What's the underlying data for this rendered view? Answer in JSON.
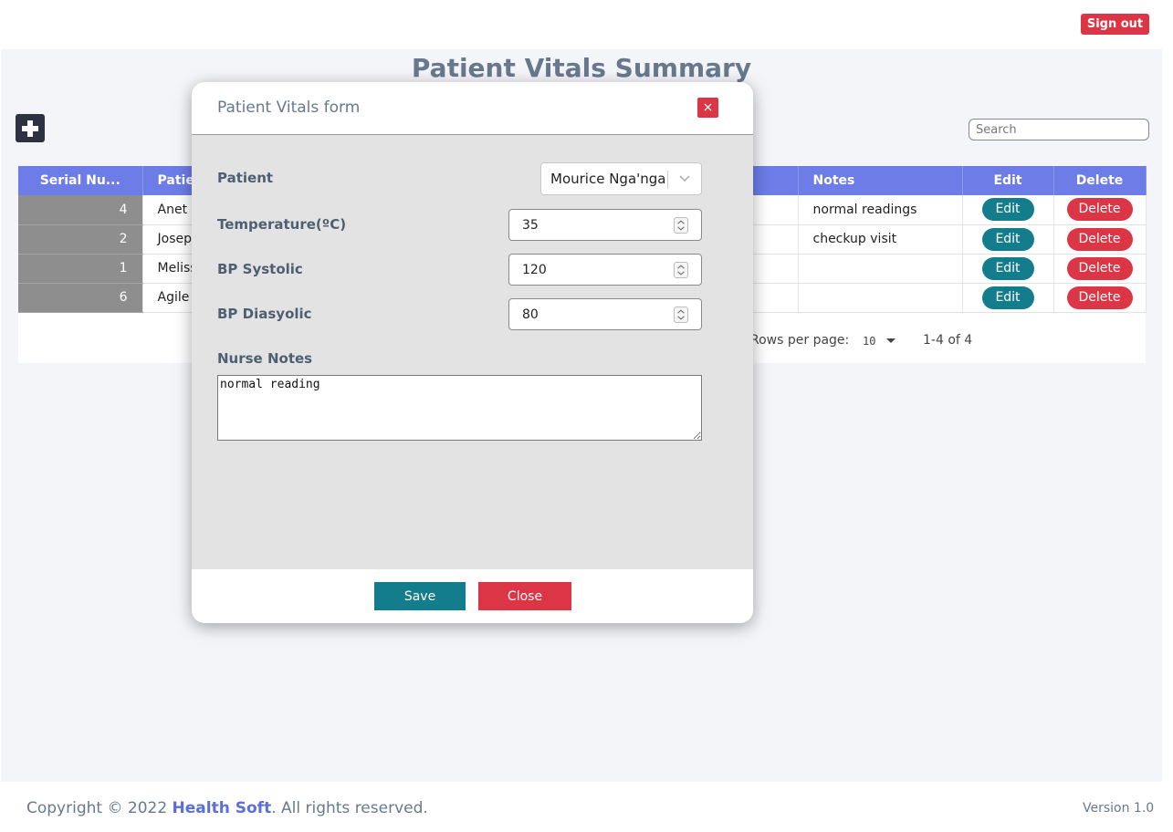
{
  "header": {
    "signout_label": "Sign out"
  },
  "page": {
    "title": "Patient Vitals Summary",
    "search_placeholder": "Search",
    "add_icon": "plus-square-icon"
  },
  "table": {
    "columns": [
      "Serial Nu...",
      "Patient",
      "Notes",
      "Edit",
      "Delete"
    ],
    "rows": [
      {
        "serial": "4",
        "patient": "Anet",
        "notes": "normal readings",
        "edit": "Edit",
        "delete": "Delete"
      },
      {
        "serial": "2",
        "patient": "Josep",
        "notes": "checkup visit",
        "edit": "Edit",
        "delete": "Delete"
      },
      {
        "serial": "1",
        "patient": "Meliss",
        "notes": "",
        "edit": "Edit",
        "delete": "Delete"
      },
      {
        "serial": "6",
        "patient": "Agile",
        "notes": "",
        "edit": "Edit",
        "delete": "Delete"
      }
    ]
  },
  "pagination": {
    "rows_per_page_label": "Rows per page:",
    "rows_per_page_value": "10",
    "range": "1-4 of 4"
  },
  "modal": {
    "title": "Patient Vitals form",
    "close_glyph": "×",
    "patient_label": "Patient",
    "patient_value": "Mourice Nga'nga",
    "temperature_label": "Temperature(ºC)",
    "temperature_value": "35",
    "bp_systolic_label": "BP Systolic",
    "bp_systolic_value": "120",
    "bp_diastolic_label": "BP Diasyolic",
    "bp_diastolic_value": "80",
    "nurse_notes_label": "Nurse Notes",
    "nurse_notes_value": "normal reading",
    "save_label": "Save",
    "close_label": "Close"
  },
  "footer": {
    "copyright_prefix": "Copyright © 2022 ",
    "brand": "Health Soft",
    "copyright_suffix": ". All rights reserved.",
    "version": "Version 1.0"
  },
  "colors": {
    "accent_blue": "#6e7ce8",
    "teal": "#137d8d",
    "danger": "#dc3545"
  }
}
